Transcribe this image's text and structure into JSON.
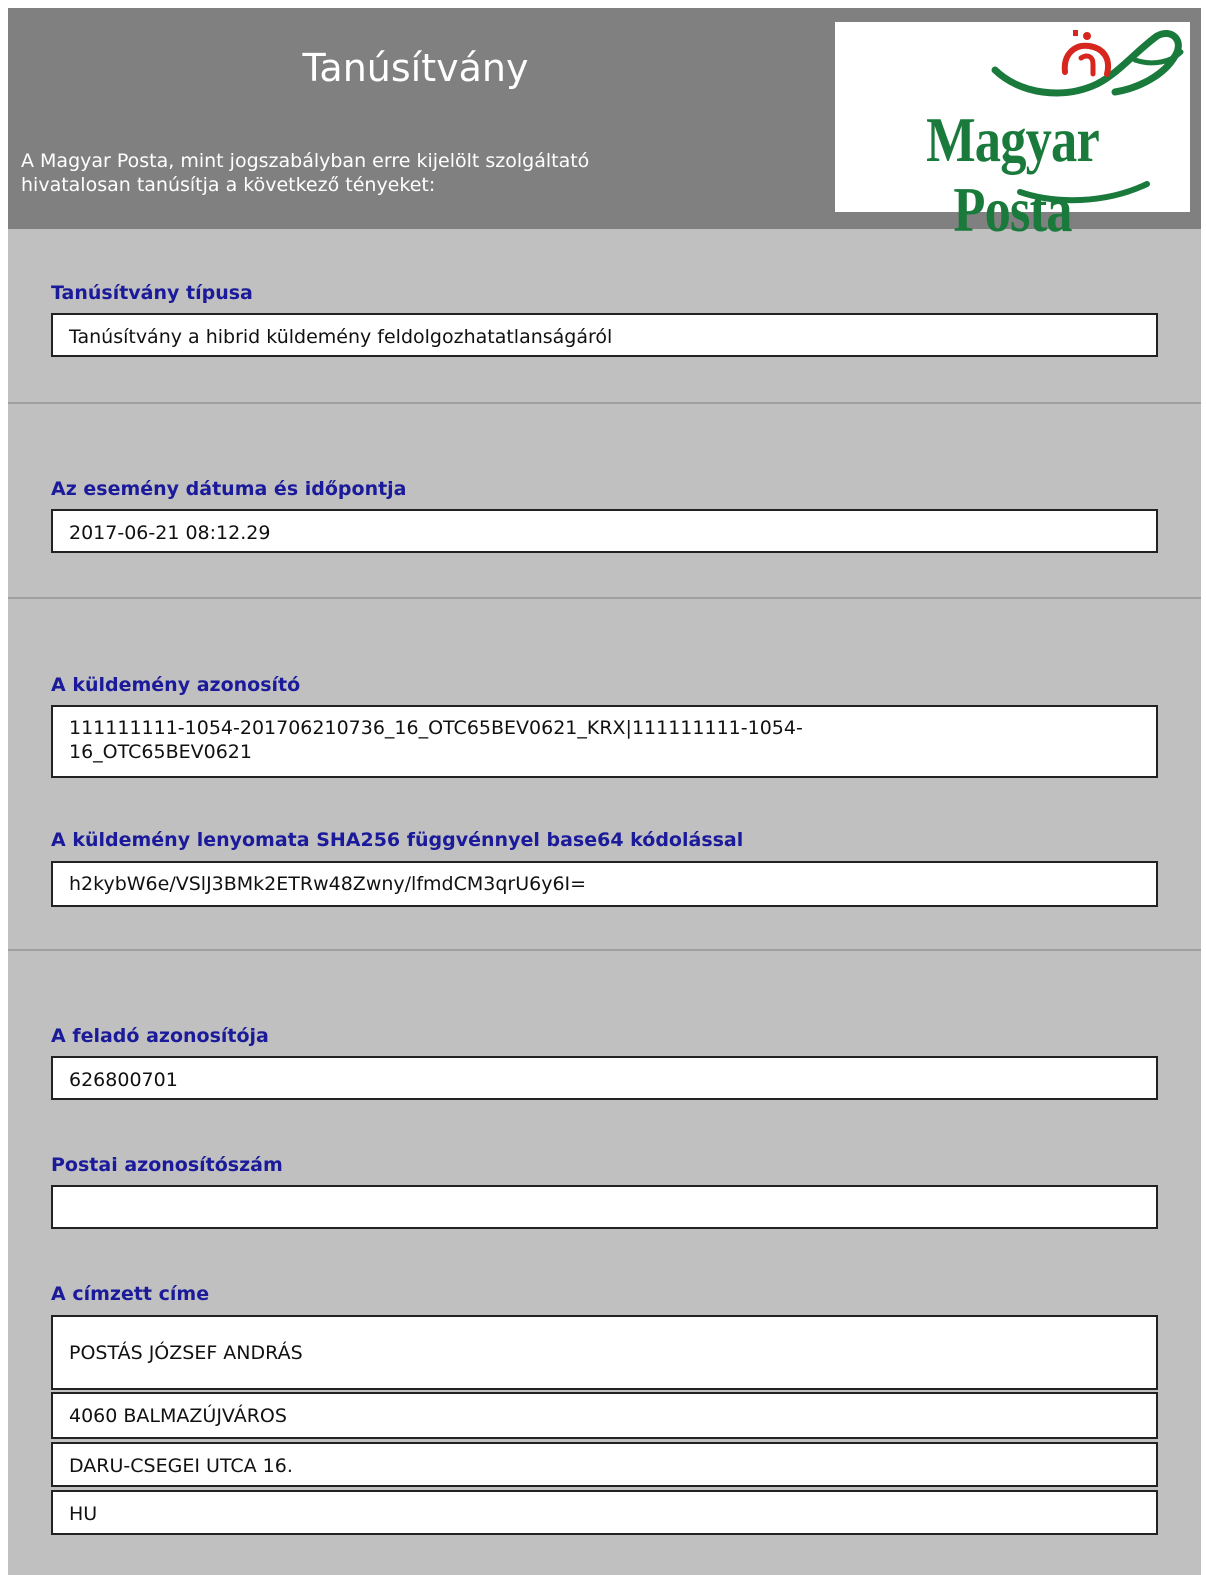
{
  "header": {
    "title": "Tanúsítvány",
    "subtitle_line1": "A Magyar Posta, mint jogszabályban erre kijelölt szolgáltató",
    "subtitle_line2": "hivatalosan tanúsítja a következő tényeket:",
    "logo_text": "Magyar Posta",
    "logo_colors": {
      "green": "#1a7a3c",
      "red": "#d7261e"
    }
  },
  "fields": {
    "certificate_type": {
      "label": "Tanúsítvány típusa",
      "value": "Tanúsítvány a hibrid küldemény feldolgozhatatlanságáról"
    },
    "event_datetime": {
      "label": "Az esemény dátuma és időpontja",
      "value": "2017-06-21 08:12.29"
    },
    "item_id": {
      "label": "A küldemény azonosító",
      "value_line1": "111111111-1054-201706210736_16_OTC65BEV0621_KRX|111111111-1054-",
      "value_line2": "16_OTC65BEV0621"
    },
    "item_hash": {
      "label": "A küldemény lenyomata SHA256 függvénnyel base64 kódolással",
      "value": "h2kybW6e/VSlJ3BMk2ETRw48Zwny/lfmdCM3qrU6y6I="
    },
    "sender_id": {
      "label": "A feladó azonosítója",
      "value": "626800701"
    },
    "postal_id": {
      "label": "Postai azonosítószám",
      "value": ""
    },
    "recipient_address": {
      "label": "A címzett címe",
      "lines": [
        "POSTÁS JÓZSEF ANDRÁS",
        "4060 BALMAZÚJVÁROS",
        "DARU-CSEGEI UTCA 16.",
        "HU"
      ]
    }
  },
  "colors": {
    "header_bg": "#808080",
    "body_bg": "#c0c0c0",
    "label": "#1a1a9a"
  }
}
